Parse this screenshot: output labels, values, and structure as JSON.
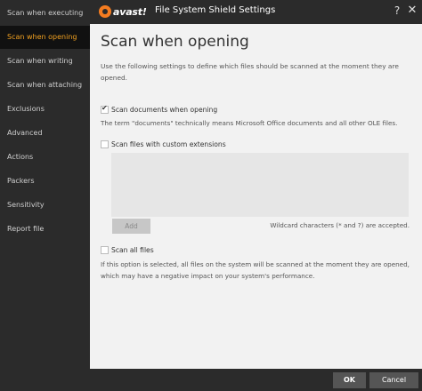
{
  "sidebar": {
    "items": [
      {
        "label": "Scan when executing"
      },
      {
        "label": "Scan when opening"
      },
      {
        "label": "Scan when writing"
      },
      {
        "label": "Scan when attaching"
      },
      {
        "label": "Exclusions"
      },
      {
        "label": "Advanced"
      },
      {
        "label": "Actions"
      },
      {
        "label": "Packers"
      },
      {
        "label": "Sensitivity"
      },
      {
        "label": "Report file"
      }
    ],
    "active_index": 1
  },
  "header": {
    "logo_text": "avast!",
    "title": "File System Shield Settings",
    "help_glyph": "?",
    "close_glyph": "✕"
  },
  "main": {
    "title": "Scan when opening",
    "intro": "Use the following settings to define which files should be scanned at the moment they are opened.",
    "scan_documents": {
      "label": "Scan documents when opening",
      "checked": true,
      "note": "The term \"documents\" technically means Microsoft Office documents and all other OLE files."
    },
    "scan_custom": {
      "label": "Scan files with custom extensions",
      "checked": false
    },
    "add_label": "Add",
    "wildcard_note": "Wildcard characters (* and ?) are accepted.",
    "scan_all": {
      "label": "Scan all files",
      "checked": false,
      "note": "If this option is selected, all files on the system will be scanned at the moment they are opened, which may have a negative impact on your system's performance."
    }
  },
  "footer": {
    "ok_label": "OK",
    "cancel_label": "Cancel"
  },
  "colors": {
    "accent": "#f0a020",
    "sidebar_bg": "#2b2b2b",
    "content_bg": "#f2f2f2"
  }
}
